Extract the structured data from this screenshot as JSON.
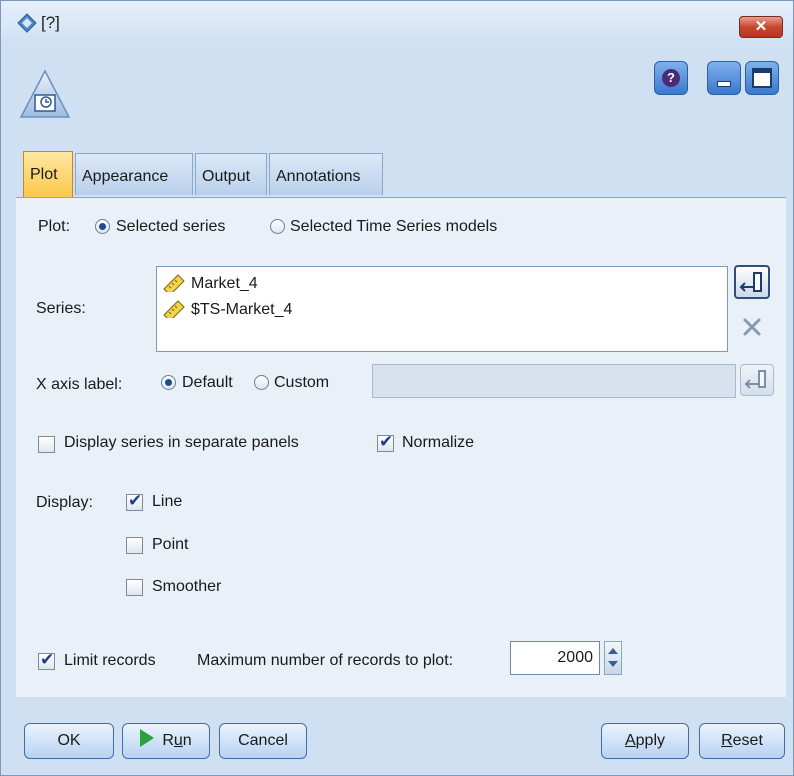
{
  "window": {
    "title": "[?]"
  },
  "tabs": [
    {
      "label": "Plot",
      "active": true
    },
    {
      "label": "Appearance",
      "active": false
    },
    {
      "label": "Output",
      "active": false
    },
    {
      "label": "Annotations",
      "active": false
    }
  ],
  "plot": {
    "label": "Plot:",
    "options": [
      {
        "label": "Selected series",
        "selected": true
      },
      {
        "label": "Selected Time Series models",
        "selected": false
      }
    ]
  },
  "series": {
    "label": "Series:",
    "items": [
      "Market_4",
      "$TS-Market_4"
    ]
  },
  "x_axis": {
    "label": "X axis label:",
    "options": [
      {
        "label": "Default",
        "selected": true
      },
      {
        "label": "Custom",
        "selected": false
      }
    ],
    "custom_value": ""
  },
  "display_separate": {
    "label": "Display series in separate panels",
    "checked": false
  },
  "normalize": {
    "label": "Normalize",
    "checked": true
  },
  "display": {
    "label": "Display:",
    "options": [
      {
        "label": "Line",
        "checked": true
      },
      {
        "label": "Point",
        "checked": false
      },
      {
        "label": "Smoother",
        "checked": false
      }
    ]
  },
  "limit": {
    "label": "Limit records",
    "checked": true,
    "max_label": "Maximum number of records to plot:",
    "max_value": "2000"
  },
  "buttons": {
    "ok": "OK",
    "run_prefix": "R",
    "run_underline": "u",
    "run_suffix": "n",
    "cancel": "Cancel",
    "apply_underline": "A",
    "apply_rest": "pply",
    "reset_underline": "R",
    "reset_rest": "eset"
  },
  "icons": {
    "window": "stream-node-icon",
    "node": "time-plot-node-icon",
    "help": "help-icon",
    "minimize": "minimize-icon",
    "maximize": "maximize-icon",
    "close": "close-icon",
    "field": "continuous-field-ruler-icon"
  },
  "colors": {
    "tab_active": "#fbc74c",
    "panel": "#e9f0f8",
    "chrome": "#cfe0f2",
    "close": "#c9462f"
  }
}
